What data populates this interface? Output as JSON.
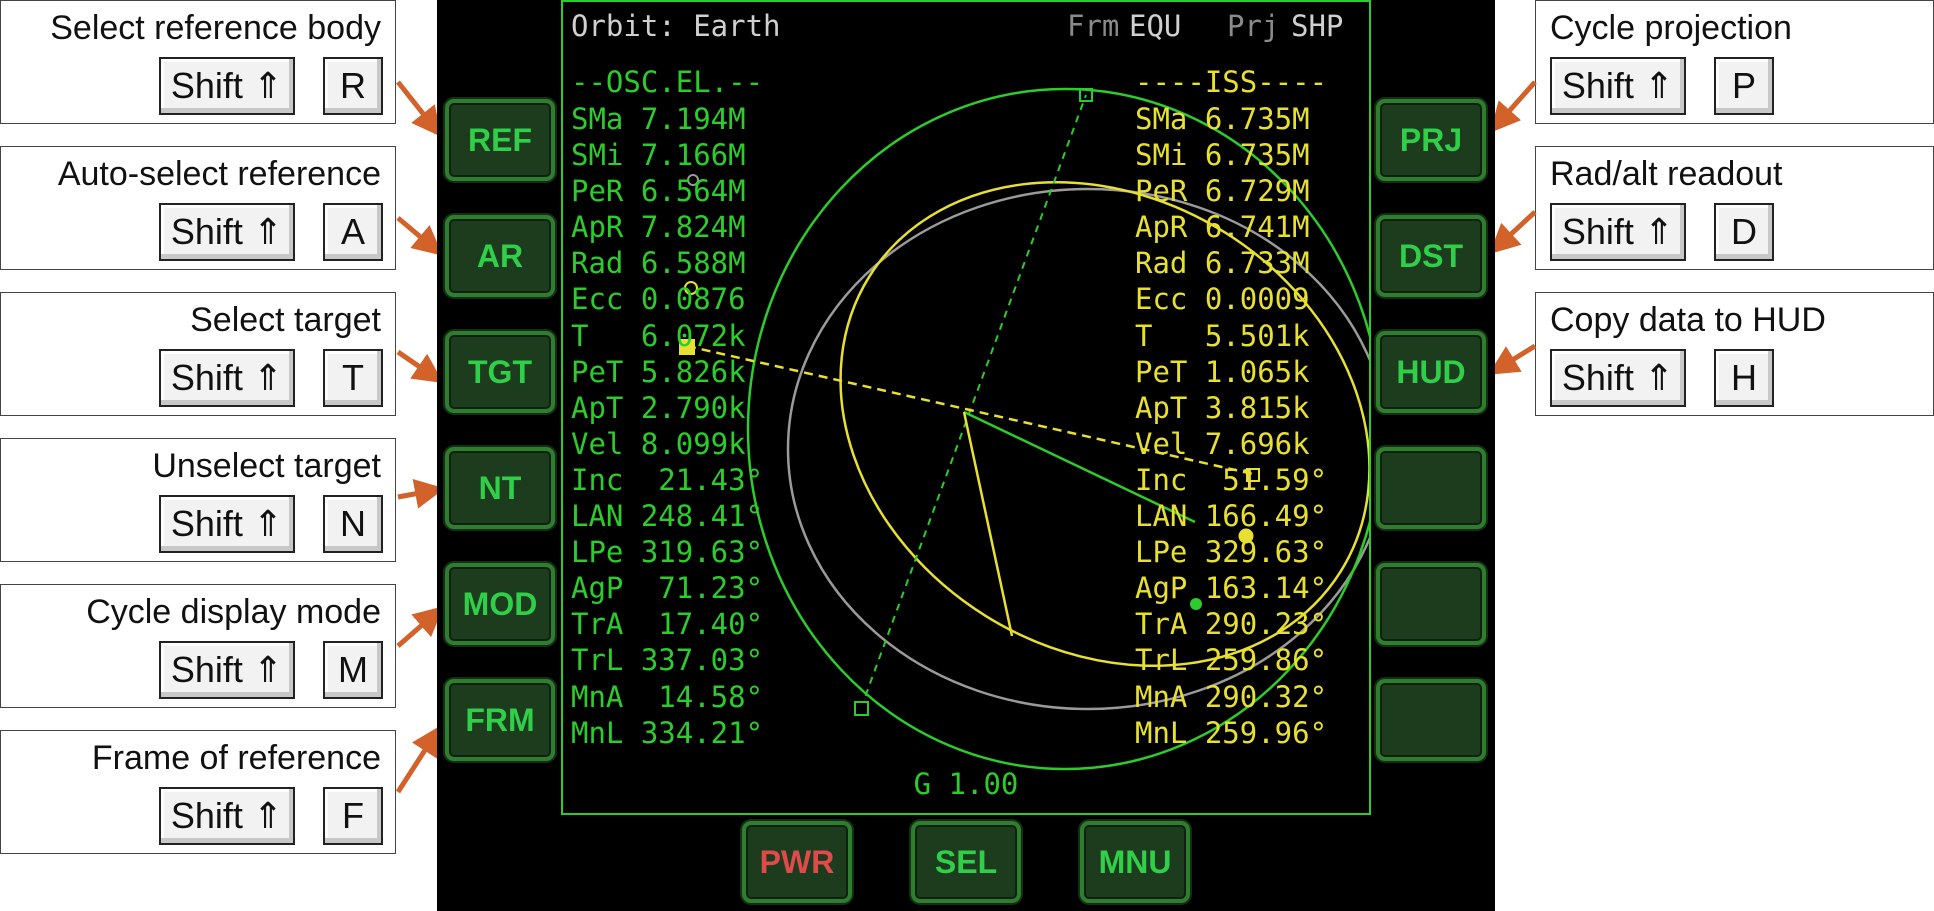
{
  "callouts_left": [
    {
      "title": "Select reference body",
      "mod": "Shift ⇑",
      "key": "R"
    },
    {
      "title": "Auto-select reference",
      "mod": "Shift ⇑",
      "key": "A"
    },
    {
      "title": "Select target",
      "mod": "Shift ⇑",
      "key": "T"
    },
    {
      "title": "Unselect target",
      "mod": "Shift ⇑",
      "key": "N"
    },
    {
      "title": "Cycle display mode",
      "mod": "Shift ⇑",
      "key": "M"
    },
    {
      "title": "Frame of reference",
      "mod": "Shift ⇑",
      "key": "F"
    }
  ],
  "callouts_right": [
    {
      "title": "Cycle projection",
      "mod": "Shift ⇑",
      "key": "P"
    },
    {
      "title": "Rad/alt readout",
      "mod": "Shift ⇑",
      "key": "D"
    },
    {
      "title": "Copy data to HUD",
      "mod": "Shift ⇑",
      "key": "H"
    }
  ],
  "buttons_left": [
    "REF",
    "AR",
    "TGT",
    "NT",
    "MOD",
    "FRM"
  ],
  "buttons_right": [
    "PRJ",
    "DST",
    "HUD",
    "",
    "",
    ""
  ],
  "buttons_bottom": [
    "PWR",
    "SEL",
    "MNU"
  ],
  "mfd": {
    "title": "Orbit: Earth",
    "frm_label": "Frm",
    "frm_value": "EQU",
    "prj_label": "Prj",
    "prj_value": "SHP",
    "left_header": "--OSC.EL.--",
    "right_header": "----ISS----",
    "left_rows": [
      "SMa 7.194M",
      "SMi 7.166M",
      "PeR 6.564M",
      "ApR 7.824M",
      "Rad 6.588M",
      "Ecc 0.0876",
      "T   6.072k",
      "PeT 5.826k",
      "ApT 2.790k",
      "Vel 8.099k",
      "Inc  21.43°",
      "LAN 248.41°",
      "LPe 319.63°",
      "AgP  71.23°",
      "TrA  17.40°",
      "TrL 337.03°",
      "MnA  14.58°",
      "MnL 334.21°"
    ],
    "right_rows": [
      "SMa 6.735M",
      "SMi 6.735M",
      "PeR 6.729M",
      "ApR 6.741M",
      "Rad 6.733M",
      "Ecc 0.0009",
      "T   5.501k",
      "PeT 1.065k",
      "ApT 3.815k",
      "Vel 7.696k",
      "Inc  51.59°",
      "LAN 166.49°",
      "LPe 329.63°",
      "AgP 163.14°",
      "TrA 290.23°",
      "TrL 259.86°",
      "MnA 290.32°",
      "MnL 259.96°"
    ],
    "time_accel": "G 1.00",
    "colors": {
      "green": "#2ccc2c",
      "yellow": "#e8e030",
      "gray": "#9a9a9a",
      "title": "#d0d0d0"
    }
  }
}
